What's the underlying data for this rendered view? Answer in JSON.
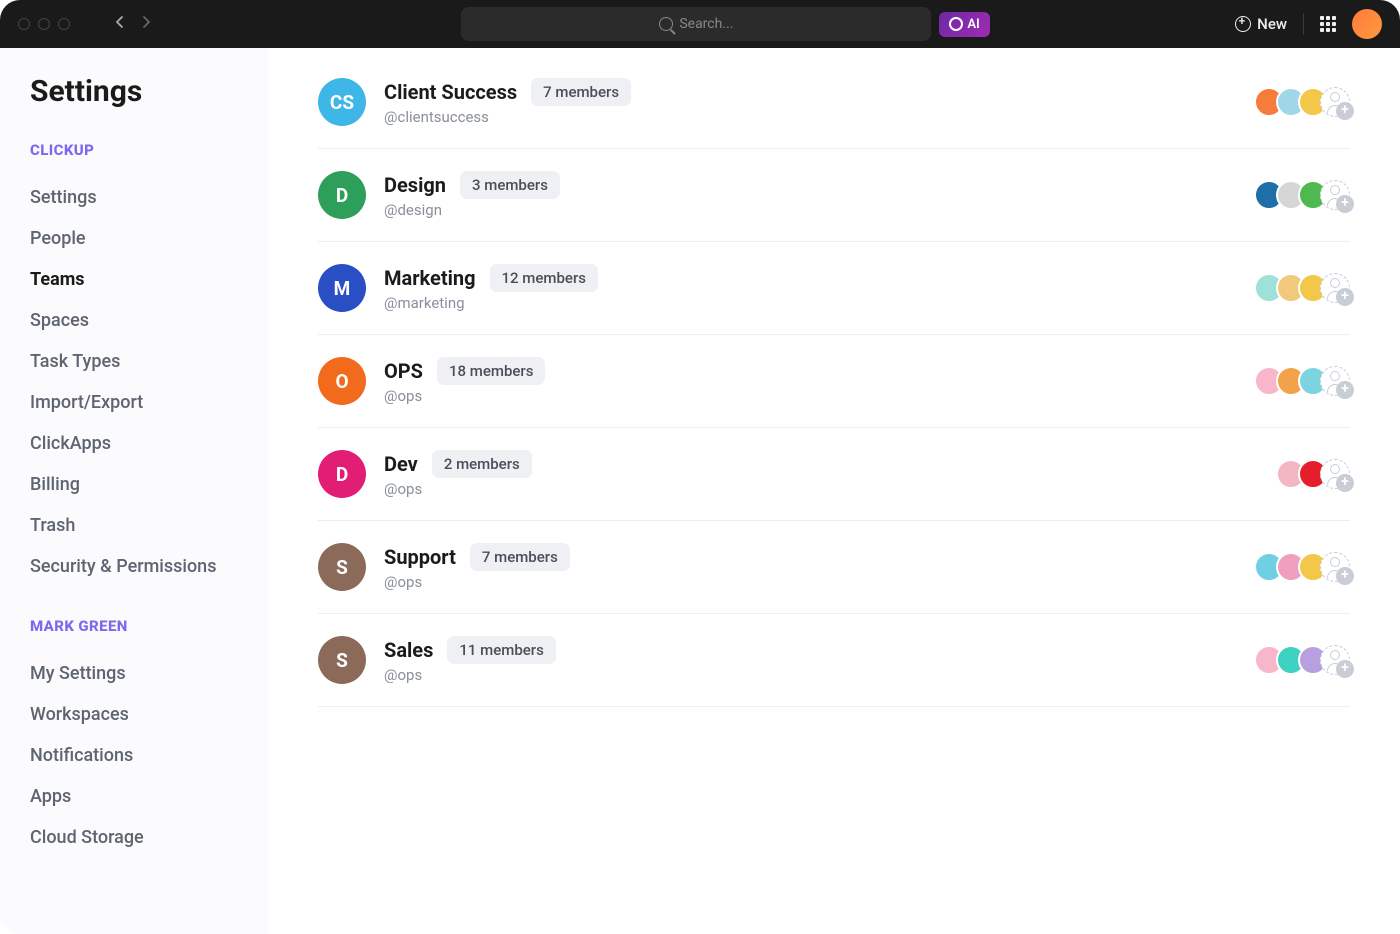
{
  "topbar": {
    "search_placeholder": "Search...",
    "ai_label": "AI",
    "new_label": "New"
  },
  "sidebar": {
    "title": "Settings",
    "section1_label": "CLICKUP",
    "section1_items": [
      "Settings",
      "People",
      "Teams",
      "Spaces",
      "Task Types",
      "Import/Export",
      "ClickApps",
      "Billing",
      "Trash",
      "Security & Permissions"
    ],
    "section1_active_index": 2,
    "section2_label": "MARK GREEN",
    "section2_items": [
      "My Settings",
      "Workspaces",
      "Notifications",
      "Apps",
      "Cloud Storage"
    ]
  },
  "teams": [
    {
      "initials": "CS",
      "color": "#3fb6e8",
      "name": "Client Success",
      "handle": "@clientsuccess",
      "members": "7 members",
      "avatars": [
        "#f57c3a",
        "#9fd6e8",
        "#f3c84a"
      ]
    },
    {
      "initials": "D",
      "color": "#2e9e5b",
      "name": "Design",
      "handle": "@design",
      "members": "3 members",
      "avatars": [
        "#1e6fa8",
        "#d6d6d6",
        "#4fb84f"
      ]
    },
    {
      "initials": "M",
      "color": "#2a4fc4",
      "name": "Marketing",
      "handle": "@marketing",
      "members": "12 members",
      "avatars": [
        "#9fe0d9",
        "#f0c97a",
        "#f3c84a"
      ]
    },
    {
      "initials": "O",
      "color": "#f26a1b",
      "name": "OPS",
      "handle": "@ops",
      "members": "18 members",
      "avatars": [
        "#f7b6c9",
        "#f2a24a",
        "#7ed3e0"
      ]
    },
    {
      "initials": "D",
      "color": "#e11d74",
      "name": "Dev",
      "handle": "@ops",
      "members": "2 members",
      "avatars": [
        "#f3b7c1",
        "#e61e2b"
      ]
    },
    {
      "initials": "S",
      "color": "#8c6a5a",
      "name": "Support",
      "handle": "@ops",
      "members": "7 members",
      "avatars": [
        "#6fd0e4",
        "#f09fbf",
        "#f3c84a"
      ]
    },
    {
      "initials": "S",
      "color": "#8c6a5a",
      "name": "Sales",
      "handle": "@ops",
      "members": "11 members",
      "avatars": [
        "#f7b6c9",
        "#3fd1c2",
        "#b89fe0"
      ]
    }
  ]
}
